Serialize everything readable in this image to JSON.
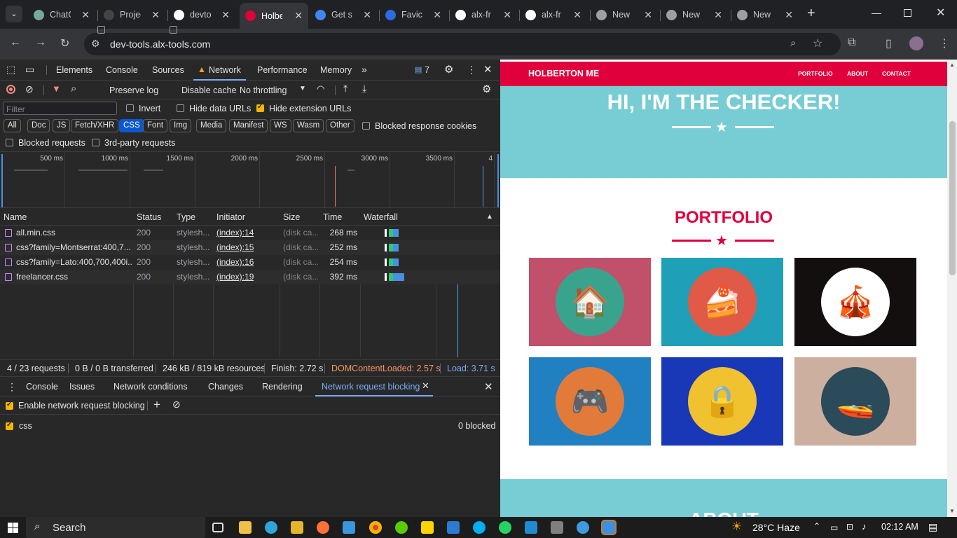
{
  "tabs": [
    {
      "label": "ChatG",
      "icon": "chatgpt-icon",
      "color": "#74aa9c"
    },
    {
      "label": "Projec",
      "icon": "alx-icon",
      "color": "#444"
    },
    {
      "label": "devto",
      "icon": "github-icon",
      "color": "#fff"
    },
    {
      "label": "Holbe",
      "icon": "holberton-icon",
      "color": "#e0003c"
    },
    {
      "label": "Get st",
      "icon": "google-icon",
      "color": "#4285f4"
    },
    {
      "label": "Favico",
      "icon": "realfavicon-icon",
      "color": "#2d6ae3"
    },
    {
      "label": "alx-fr",
      "icon": "github-icon",
      "color": "#fff"
    },
    {
      "label": "alx-fr",
      "icon": "github-icon",
      "color": "#fff"
    },
    {
      "label": "New",
      "icon": "chrome-icon",
      "color": "#9aa0a6"
    },
    {
      "label": "New",
      "icon": "chrome-icon",
      "color": "#9aa0a6"
    },
    {
      "label": "New",
      "icon": "chrome-icon",
      "color": "#9aa0a6"
    }
  ],
  "url": "dev-tools.alx-tools.com",
  "devtools": {
    "panels": [
      "Elements",
      "Console",
      "Sources",
      "Network",
      "Performance",
      "Memory"
    ],
    "issues_count": "7",
    "network_toolbar": {
      "preserve_log": "Preserve log",
      "disable_cache": "Disable cache",
      "throttling": "No throttling"
    },
    "filter": {
      "placeholder": "Filter",
      "invert": "Invert",
      "hide_data": "Hide data URLs",
      "hide_ext": "Hide extension URLs"
    },
    "type_filters": [
      "All",
      "Doc",
      "JS",
      "Fetch/XHR",
      "CSS",
      "Font",
      "Img",
      "Media",
      "Manifest",
      "WS",
      "Wasm",
      "Other"
    ],
    "blocked_cookies": "Blocked response cookies",
    "blocked_requests": "Blocked requests",
    "third_party": "3rd-party requests",
    "timeline_ticks": [
      "500 ms",
      "1000 ms",
      "1500 ms",
      "2000 ms",
      "2500 ms",
      "3000 ms",
      "3500 ms",
      "4"
    ],
    "columns": [
      "Name",
      "Status",
      "Type",
      "Initiator",
      "Size",
      "Time",
      "Waterfall"
    ],
    "rows": [
      {
        "name": "all.min.css",
        "status": "200",
        "type": "stylesh...",
        "initiator": "(index):14",
        "size": "(disk ca...",
        "time": "268 ms"
      },
      {
        "name": "css?family=Montserrat:400,7...",
        "status": "200",
        "type": "stylesh...",
        "initiator": "(index):15",
        "size": "(disk ca...",
        "time": "252 ms"
      },
      {
        "name": "css?family=Lato:400,700,400i...",
        "status": "200",
        "type": "stylesh...",
        "initiator": "(index):16",
        "size": "(disk ca...",
        "time": "254 ms"
      },
      {
        "name": "freelancer.css",
        "status": "200",
        "type": "stylesh...",
        "initiator": "(index):19",
        "size": "(disk ca...",
        "time": "392 ms"
      }
    ],
    "status_bar": {
      "requests": "4 / 23 requests",
      "transferred": "0 B / 0 B transferred",
      "resources": "246 kB / 819 kB resources",
      "finish": "Finish: 2.72 s",
      "dcl": "DOMContentLoaded: 2.57 s",
      "load": "Load: 3.71 s"
    },
    "drawer_tabs": [
      "Console",
      "Issues",
      "Network conditions",
      "Changes",
      "Rendering",
      "Network request blocking"
    ],
    "enable_blocking": "Enable network request blocking",
    "pattern": "css",
    "blocked_count": "0 blocked"
  },
  "site": {
    "brand": "HOLBERTON ME",
    "nav": [
      "PORTFOLIO",
      "ABOUT",
      "CONTACT"
    ],
    "hero_title": "HI, I'M THE CHECKER!",
    "portfolio_title": "PORTFOLIO",
    "about_title": "ABOUT",
    "tiles": [
      {
        "bg": "#c1506a",
        "circle": "#3aa38e",
        "icon": "cabin-icon",
        "glyph": "🏠"
      },
      {
        "bg": "#20a0b8",
        "circle": "#e05a47",
        "icon": "cake-icon",
        "glyph": "🍰"
      },
      {
        "bg": "#120f0e",
        "circle": "#ffffff",
        "icon": "circus-icon",
        "glyph": "🎪"
      },
      {
        "bg": "#2180c1",
        "circle": "#e27b3a",
        "icon": "gamepad-icon",
        "glyph": "🎮"
      },
      {
        "bg": "#1838b8",
        "circle": "#f0c230",
        "icon": "safe-icon",
        "glyph": "🔒"
      },
      {
        "bg": "#ccaf9e",
        "circle": "#2b4a5a",
        "icon": "submarine-icon",
        "glyph": "🚤"
      }
    ]
  },
  "taskbar": {
    "search": "Search",
    "weather": "28°C  Haze",
    "time": "02:12 AM"
  }
}
